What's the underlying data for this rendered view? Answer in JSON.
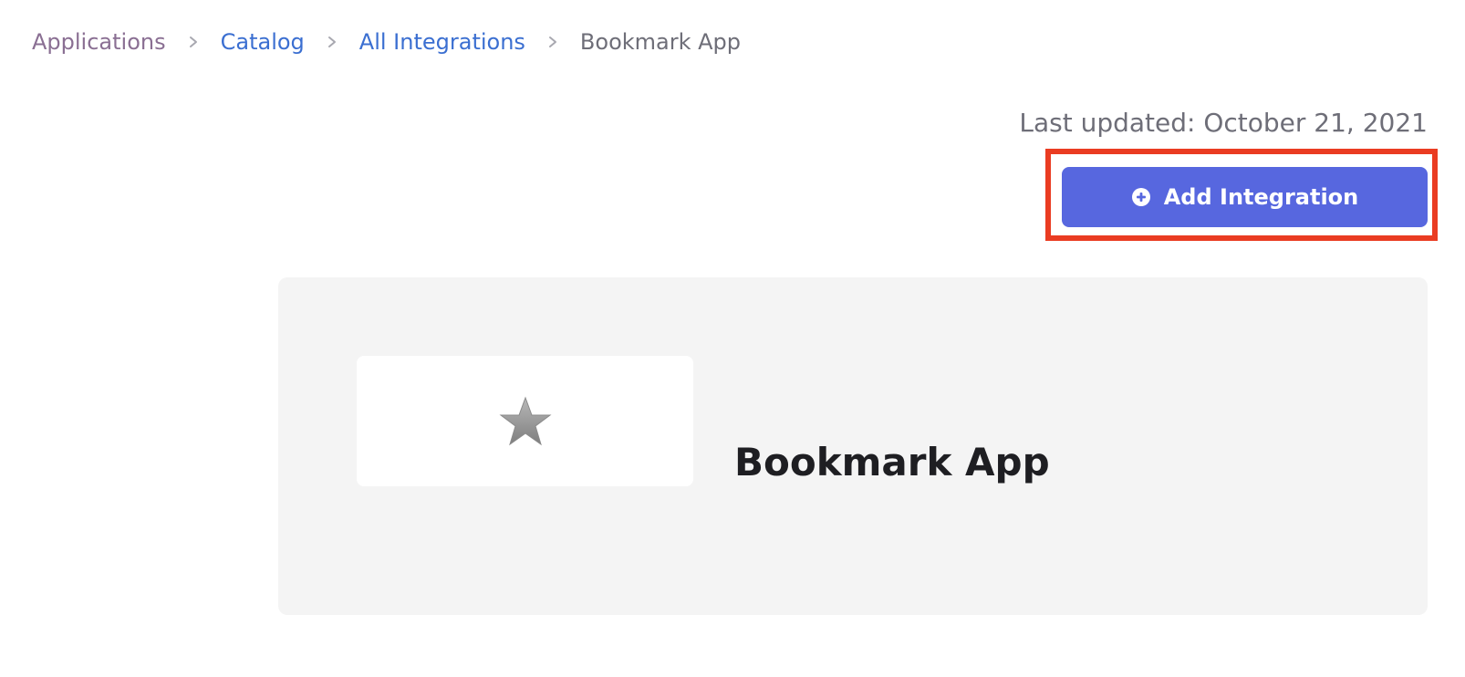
{
  "breadcrumb": {
    "items": [
      {
        "label": "Applications"
      },
      {
        "label": "Catalog"
      },
      {
        "label": "All Integrations"
      },
      {
        "label": "Bookmark App"
      }
    ]
  },
  "header": {
    "last_updated": "Last updated: October 21, 2021"
  },
  "actions": {
    "add_integration_label": "Add Integration",
    "add_integration_icon": "plus-circle-icon",
    "highlight_color": "#ea3c22",
    "button_color": "#5767df"
  },
  "app": {
    "name": "Bookmark App",
    "logo_icon": "star-icon"
  }
}
